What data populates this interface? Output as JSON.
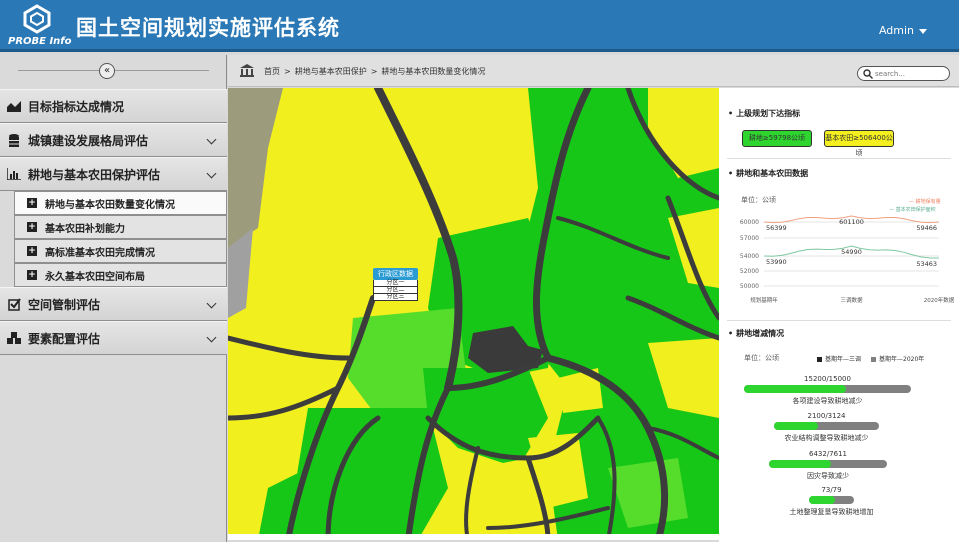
{
  "header": {
    "logo_text": "PROBE Info",
    "title": "国土空间规划实施评估系统",
    "user": "Admin"
  },
  "sidebar": {
    "collapse_glyph": "«",
    "items": [
      {
        "label": "目标指标达成情况",
        "icon": "area-chart-icon"
      },
      {
        "label": "城镇建设发展格局评估",
        "icon": "database-icon"
      },
      {
        "label": "耕地与基本农田保护评估",
        "icon": "bar-chart-icon"
      },
      {
        "label": "空间管制评估",
        "icon": "checkbox-icon"
      },
      {
        "label": "要素配置评估",
        "icon": "cubes-icon"
      }
    ],
    "sub_items": [
      {
        "label": "耕地与基本农田数量变化情况"
      },
      {
        "label": "基本农田补划能力"
      },
      {
        "label": "高标准基本农田完成情况"
      },
      {
        "label": "永久基本农田空间布局"
      }
    ]
  },
  "breadcrumb": {
    "items": [
      "首页",
      ">",
      "耕地与基本农田保护",
      ">",
      "耕地与基本农田数量变化情况"
    ]
  },
  "search": {
    "placeholder": "search..."
  },
  "map": {
    "district_title": "行政区数据",
    "district_options": [
      "分区一",
      "分区二",
      "分区三"
    ]
  },
  "panel": {
    "section1_title": "上级规划下达指标",
    "tag_green": "耕地≥59798公顷",
    "tag_yellow": "基本农田≥506400公顷",
    "section2_title": "耕地和基本农田数据",
    "unit": "单位：公顷",
    "legend_top": "耕地保有量",
    "legend_bottom": "基本农田保护面积",
    "section3_title": "耕地增减情况",
    "unit3": "单位：公顷",
    "legend3_a": "基期年—三调",
    "legend3_b": "基期年—2020年"
  },
  "chart_data": [
    {
      "type": "line",
      "title": "耕地和基本农田数据",
      "ylabel": "单位：公顷",
      "ylim": [
        50000,
        61000
      ],
      "yticks": [
        "60000",
        "57000",
        "54000",
        "52000",
        "50000"
      ],
      "categories": [
        "规划基期年",
        "三调数据",
        "2020年数据"
      ],
      "series": [
        {
          "name": "耕地保有量",
          "color": "#f0a080",
          "values": [
            59399,
            60100,
            59466
          ],
          "labels": [
            "56399",
            "601100",
            "59466"
          ]
        },
        {
          "name": "基本农田保护面积",
          "color": "#7fc8a0",
          "values": [
            53990,
            54990,
            53463
          ],
          "labels": [
            "53990",
            "54990",
            "53463"
          ]
        }
      ]
    },
    {
      "type": "bar",
      "title": "耕地增减情况",
      "series_names": [
        "基期年—三调",
        "基期年—2020年"
      ],
      "categories": [
        "各项建设导致耕地减少",
        "农业结构调整导致耕地减少",
        "因灾导致减少",
        "土地整理复垦导致耕地增加"
      ],
      "values_a": [
        15200,
        2100,
        6432,
        73
      ],
      "values_b": [
        15000,
        3124,
        7611,
        79
      ],
      "value_labels": [
        "15200/15000",
        "2100/3124",
        "6432/7611",
        "73/79"
      ]
    }
  ]
}
